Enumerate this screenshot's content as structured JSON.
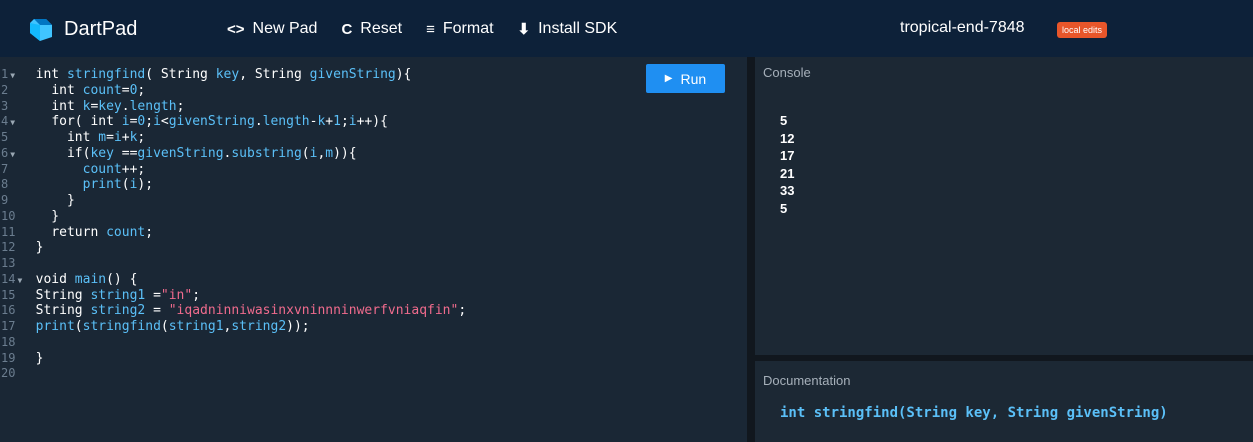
{
  "app": {
    "name": "DartPad",
    "pad_name": "tropical-end-7848",
    "badge": "local edits"
  },
  "toolbar": {
    "new_pad": {
      "icon": "<>",
      "label": "New Pad"
    },
    "reset": {
      "icon": "C",
      "label": "Reset"
    },
    "format": {
      "icon": "≡",
      "label": "Format"
    },
    "install_sdk": {
      "icon": "⬇",
      "label": "Install SDK"
    }
  },
  "editor": {
    "run_label": "Run",
    "line_numbers": [
      "1",
      "2",
      "3",
      "4",
      "5",
      "6",
      "7",
      "8",
      "9",
      "10",
      "11",
      "12",
      "13",
      "14",
      "15",
      "16",
      "17",
      "18",
      "19",
      "20"
    ],
    "fold_lines": [
      "1",
      "4",
      "6",
      "14"
    ]
  },
  "console": {
    "title": "Console",
    "output": [
      "5",
      "12",
      "17",
      "21",
      "33",
      "5"
    ]
  },
  "docs": {
    "title": "Documentation",
    "signature": "int stringfind(String key, String givenString)"
  },
  "colors": {
    "header_bg": "#0d2139",
    "editor_bg": "#1a2735",
    "accent": "#1f8ff2",
    "identifier": "#5bc0f8",
    "string": "#f06b8d",
    "badge": "#e8562a"
  }
}
